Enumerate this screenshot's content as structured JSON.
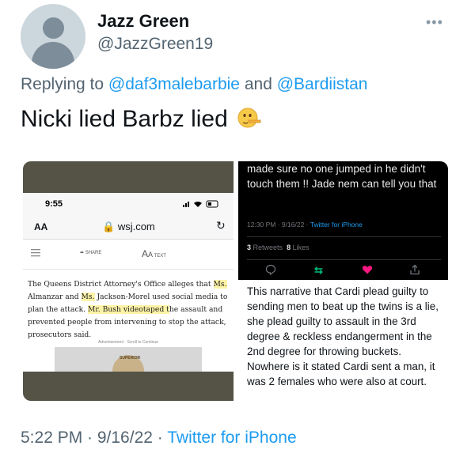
{
  "author": {
    "name": "Jazz Green",
    "handle": "@JazzGreen19"
  },
  "more_icon": "ellipsis-icon",
  "reply": {
    "prefix": "Replying to",
    "mention1": "@daf3malebarbie",
    "connector": "and",
    "mention2": "@Bardiistan"
  },
  "tweet": {
    "text": "Nicki lied Barbz lied",
    "emoji": "lying-face-emoji"
  },
  "left_image": {
    "status_time": "9:55",
    "aa": "AA",
    "url": "wsj.com",
    "share_label": "SHARE",
    "text_label": "TEXT",
    "article_parts": [
      {
        "t": "The Queens District Attorney's Office alleges that ",
        "hl": false
      },
      {
        "t": "Ms.",
        "hl": true
      },
      {
        "t": " Almanzar and ",
        "hl": false
      },
      {
        "t": "Ms.",
        "hl": true
      },
      {
        "t": " Jackson-Morel used social media to plan the attack. ",
        "hl": false
      },
      {
        "t": "Mr. Bush videotaped t",
        "hl": true
      },
      {
        "t": "he assault and prevented people from intervening to stop the attack, prosecutors said.",
        "hl": false
      }
    ],
    "ad_text": "Advertisement · Scroll to Continue",
    "seal_text": "SUPERIOR"
  },
  "right_image": {
    "text": "made sure no one jumped in he didn't touch them !! Jade nem can tell you that",
    "time": "12:30 PM · 9/16/22 ·",
    "source": "Twitter for iPhone",
    "retweets_count": "3",
    "retweets_label": "Retweets",
    "likes_count": "8",
    "likes_label": "Likes"
  },
  "body_text": "This narrative that Cardi plead guilty to sending men to beat up the twins is a lie, she plead guilty to assault in the 3rd degree & reckless endangerment in the 2nd degree for throwing buckets. Nowhere is it stated Cardi sent a man, it was 2 females who were also at court.",
  "footer": {
    "timestamp": "5:22 PM · 9/16/22 ·",
    "source": "Twitter for iPhone"
  },
  "colors": {
    "accent": "#1d9bf0",
    "secondary_text": "#536471",
    "like": "#f91880",
    "retweet": "#00ba7c"
  }
}
